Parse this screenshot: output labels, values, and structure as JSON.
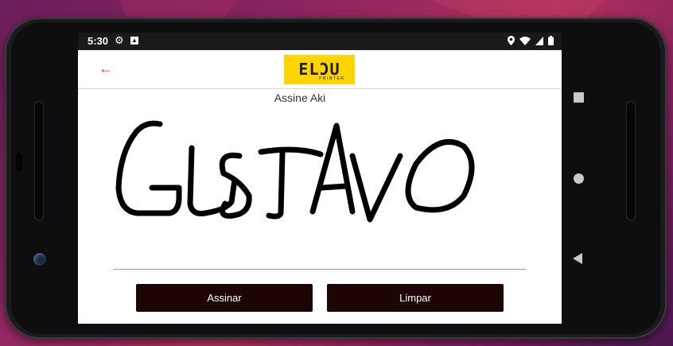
{
  "status_bar": {
    "time": "5:30"
  },
  "app_bar": {
    "logo_text": "ELƆU",
    "logo_sub": "PRINTER"
  },
  "page": {
    "title": "Assine Aki"
  },
  "signature": {
    "drawn_text": "GUSTAVO"
  },
  "buttons": {
    "sign_label": "Assinar",
    "clear_label": "Limpar"
  },
  "colors": {
    "button_bg": "#1d0506",
    "logo_bg": "#ffd400",
    "back_arrow": "#e03030"
  },
  "icons": [
    "settings-icon",
    "notification-icon",
    "location-icon",
    "wifi-icon",
    "signal-icon",
    "battery-icon",
    "back-arrow-icon",
    "overview-icon",
    "home-icon",
    "nav-back-icon"
  ]
}
